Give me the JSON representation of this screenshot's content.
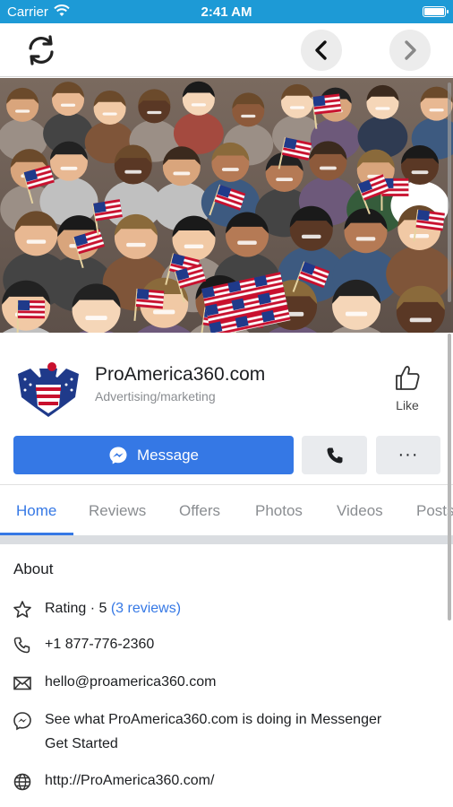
{
  "status_bar": {
    "carrier": "Carrier",
    "time": "2:41 AM",
    "battery_level": 1.0
  },
  "toolbar": {
    "refresh_icon": "refresh-icon",
    "back_icon": "chevron-left-icon",
    "forward_icon": "chevron-right-icon"
  },
  "page": {
    "name": "ProAmerica360.com",
    "category": "Advertising/marketing",
    "like_label": "Like"
  },
  "actions": {
    "message_label": "Message",
    "call_icon": "phone-icon",
    "more_label": "···"
  },
  "tabs": [
    {
      "label": "Home",
      "active": true
    },
    {
      "label": "Reviews",
      "active": false
    },
    {
      "label": "Offers",
      "active": false
    },
    {
      "label": "Photos",
      "active": false
    },
    {
      "label": "Videos",
      "active": false
    },
    {
      "label": "Posts",
      "active": false
    }
  ],
  "about": {
    "title": "About",
    "rating_prefix": "Rating · 5",
    "rating_link": "(3 reviews)",
    "phone": "+1 877-776-2360",
    "email": "hello@proamerica360.com",
    "messenger_text": "See what ProAmerica360.com is doing in Messenger",
    "messenger_link": "Get Started",
    "website": "http://ProAmerica360.com/"
  },
  "colors": {
    "accent": "#3578e5",
    "status_bar": "#1d9ad6",
    "muted": "#8a8d91"
  }
}
